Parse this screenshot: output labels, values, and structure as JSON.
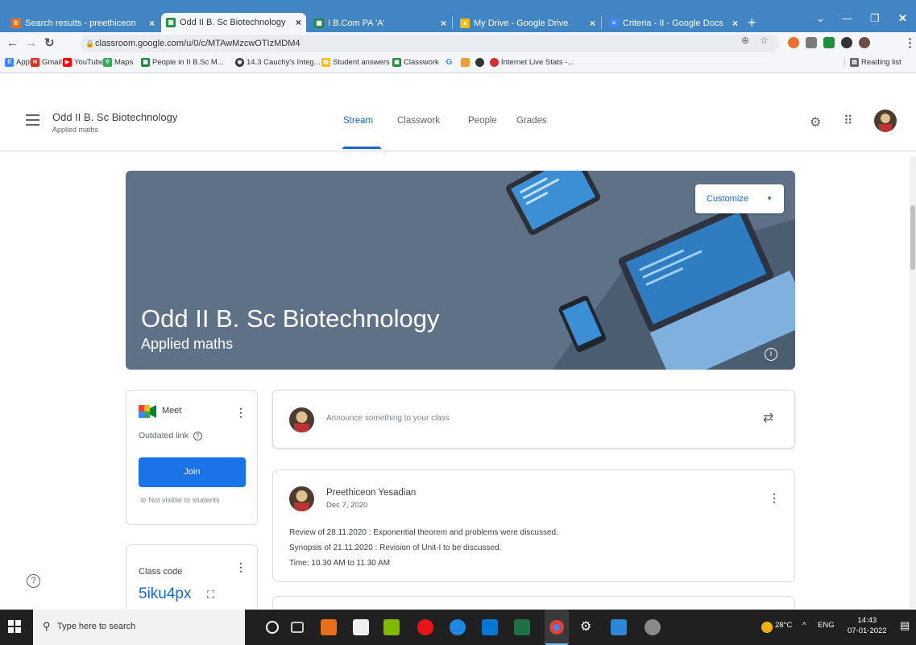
{
  "browser": {
    "tabs": [
      {
        "label": "Search results - preethiceon",
        "favicon_color": "#e8701a",
        "active": false
      },
      {
        "label": "Odd II B. Sc Biotechnology",
        "favicon_color": "#1e8e3e",
        "active": true
      },
      {
        "label": "I B.Com PA 'A'",
        "favicon_color": "#1e8e3e",
        "active": false
      },
      {
        "label": "My Drive - Google Drive",
        "favicon_color": "#fbbc04",
        "active": false
      },
      {
        "label": "Criteria - II - Google Docs",
        "favicon_color": "#4285f4",
        "active": false
      }
    ],
    "new_tab": "+",
    "url": "classroom.google.com/u/0/c/MTAwMzcwOTIzMDM4",
    "bookmarks": [
      {
        "label": "Apps",
        "color": "#4285f4"
      },
      {
        "label": "Gmail",
        "color": "#d93025"
      },
      {
        "label": "YouTube",
        "color": "#ff0000"
      },
      {
        "label": "Maps",
        "color": "#34a853"
      },
      {
        "label": "People in II B.Sc M...",
        "color": "#1e8e3e"
      },
      {
        "label": "14.3 Cauchy's Integ...",
        "color": "#333333"
      },
      {
        "label": "Student answers",
        "color": "#fbbc04"
      },
      {
        "label": "Classwork",
        "color": "#1e8e3e"
      }
    ],
    "bookmark_extra": "Internet Live Stats -...",
    "reading_list": "Reading list"
  },
  "classroom": {
    "class_name": "Odd II B. Sc Biotechnology",
    "subject": "Applied maths",
    "tabs": [
      {
        "label": "Stream",
        "active": true
      },
      {
        "label": "Classwork",
        "active": false
      },
      {
        "label": "People",
        "active": false
      },
      {
        "label": "Grades",
        "active": false
      }
    ],
    "banner": {
      "title": "Odd II B. Sc Biotechnology",
      "subtitle": "Applied maths",
      "customize_label": "Customize",
      "color": "#5e7186"
    },
    "meet": {
      "title": "Meet",
      "outdated": "Outdated link",
      "join_label": "Join",
      "visibility": "Not visible to students"
    },
    "class_code": {
      "label": "Class code",
      "code": "5iku4px"
    },
    "announce_placeholder": "Announce something to your class",
    "post": {
      "author": "Preethiceon Yesadian",
      "date": "Dec 7, 2020",
      "lines": [
        "Review of 28.11.2020 : Exponential theorem and problems were discussed.",
        "Synopsis of 21.11.2020 : Revision of Unit-I to be discussed.",
        "Time: 10.30 AM to 11.30 AM"
      ]
    }
  },
  "taskbar": {
    "search_placeholder": "Type here to search",
    "weather": "28°C",
    "language": "ENG",
    "time": "14:43",
    "date": "07-01-2022"
  },
  "colors": {
    "tabstrip": "#4285c4",
    "accent": "#1967d2",
    "join_button": "#1a73e8"
  }
}
